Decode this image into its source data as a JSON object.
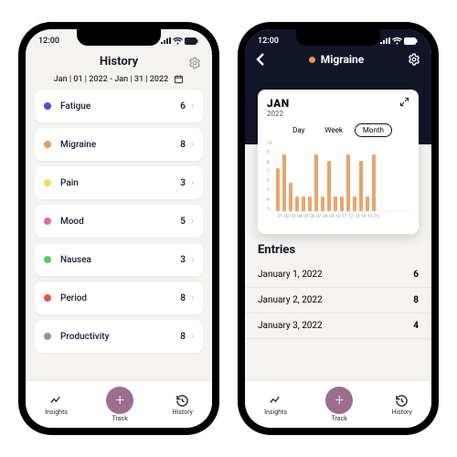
{
  "status": {
    "time": "12:00"
  },
  "palette": {
    "indigo": "#4a4de7",
    "orange": "#e59b5c",
    "yellow": "#f2d95c",
    "pink": "#e06aa6",
    "green": "#58c96b",
    "red": "#e6553f",
    "mauve": "#9d8fa3",
    "accent": "#9d6d8e"
  },
  "historyScreen": {
    "title": "History",
    "range": "Jan | 01 | 2022 - Jan | 31 | 2022",
    "items": [
      {
        "label": "Fatigue",
        "value": "6",
        "colorKey": "indigo"
      },
      {
        "label": "Migraine",
        "value": "8",
        "colorKey": "orange"
      },
      {
        "label": "Pain",
        "value": "3",
        "colorKey": "yellow"
      },
      {
        "label": "Mood",
        "value": "5",
        "colorKey": "pink"
      },
      {
        "label": "Nausea",
        "value": "3",
        "colorKey": "green"
      },
      {
        "label": "Period",
        "value": "8",
        "colorKey": "red"
      },
      {
        "label": "Productivity",
        "value": "8",
        "colorKey": "mauve"
      }
    ]
  },
  "detailScreen": {
    "title": "Migraine",
    "month": "JAN",
    "year": "2022",
    "segments": {
      "day": "Day",
      "week": "Week",
      "month": "Month",
      "active": "month"
    },
    "entriesTitle": "Entries",
    "entries": [
      {
        "date": "January 1, 2022",
        "value": "6"
      },
      {
        "date": "January 2, 2022",
        "value": "8"
      },
      {
        "date": "January 3, 2022",
        "value": "4"
      }
    ]
  },
  "tabbar": {
    "insights": "Insights",
    "track": "Track",
    "history": "History"
  },
  "chart_data": {
    "type": "bar",
    "title": "Migraine — JAN 2022",
    "xlabel": "Day",
    "ylabel": "",
    "ylim": [
      0,
      10
    ],
    "yticks": [
      10,
      9,
      8,
      7,
      6,
      5,
      4,
      3
    ],
    "categories": [
      "01",
      "02",
      "03",
      "04",
      "05",
      "06",
      "07",
      "08",
      "09",
      "10",
      "11",
      "12",
      "13",
      "14",
      "15",
      "16"
    ],
    "values": [
      6,
      8,
      4,
      2,
      2,
      2,
      8,
      2,
      7,
      2,
      2,
      8,
      2,
      7,
      2,
      8
    ]
  }
}
